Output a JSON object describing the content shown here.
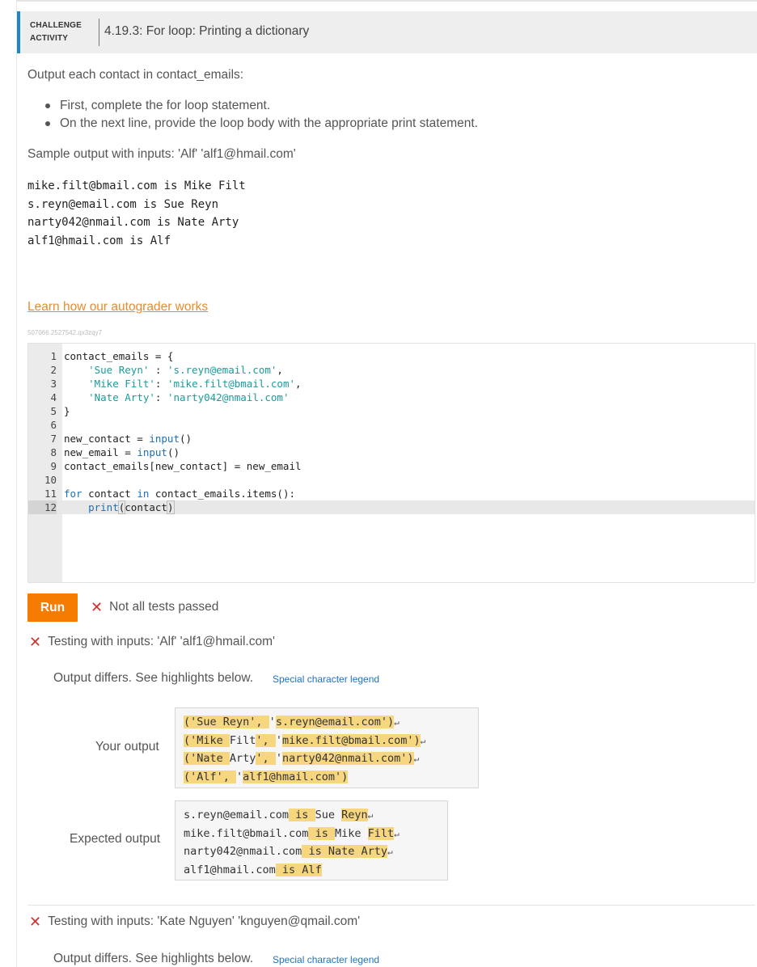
{
  "header": {
    "kind_line1": "CHALLENGE",
    "kind_line2": "ACTIVITY",
    "title": "4.19.3: For loop: Printing a dictionary"
  },
  "prompt": {
    "intro": "Output each contact in contact_emails:",
    "bullets": [
      "First, complete the for loop statement.",
      "On the next line, provide the loop body with the appropriate print statement."
    ],
    "sample_label": "Sample output with inputs: 'Alf' 'alf1@hmail.com'",
    "sample_output": [
      "mike.filt@bmail.com is Mike Filt",
      "s.reyn@email.com is Sue Reyn",
      "narty042@nmail.com is Nate Arty",
      "alf1@hmail.com is Alf"
    ]
  },
  "learn_link": "Learn how our autograder works",
  "revision_id": "507066.2527542.qx3zqy7",
  "editor": {
    "line_numbers": [
      "1",
      "2",
      "3",
      "4",
      "5",
      "6",
      "7",
      "8",
      "9",
      "10",
      "11",
      "12"
    ],
    "active_line": 12
  },
  "run": {
    "button_label": "Run",
    "status_text": "Not all tests passed"
  },
  "tests": [
    {
      "heading": "Testing with inputs: 'Alf' 'alf1@hmail.com'",
      "differs_text": "Output differs. See highlights below.",
      "legend_link": "Special character legend",
      "your_output_label": "Your output",
      "expected_output_label": "Expected output"
    },
    {
      "heading": "Testing with inputs: 'Kate Nguyen' 'knguyen@qmail.com'",
      "differs_text": "Output differs. See highlights below.",
      "legend_link": "Special character legend"
    }
  ],
  "colors": {
    "accent_blue": "#1e88c7",
    "run_orange": "#f57c00",
    "link_orange": "#e98b2d",
    "error_red": "#d32f2f",
    "highlight": "#f6d67e"
  }
}
